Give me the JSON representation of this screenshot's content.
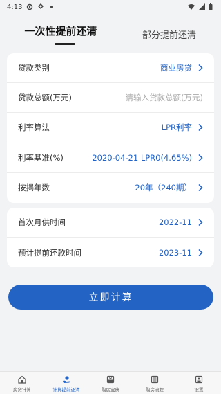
{
  "status_bar": {
    "time": "4:13"
  },
  "tabs": {
    "active_label": "一次性提前还清",
    "inactive_label": "部分提前还清"
  },
  "loan_form": {
    "rows": [
      {
        "label": "贷款类别",
        "value": "商业房贷"
      },
      {
        "label": "贷款总额(万元)",
        "placeholder": "请输入贷款总额(万元)"
      },
      {
        "label": "利率算法",
        "value": "LPR利率"
      },
      {
        "label": "利率基准(%)",
        "value": "2020-04-21 LPR0(4.65%)"
      },
      {
        "label": "按揭年数",
        "value": "20年（240期）"
      }
    ]
  },
  "date_form": {
    "rows": [
      {
        "label": "首次月供时间",
        "value": "2022-11"
      },
      {
        "label": "预计提前还款时间",
        "value": "2023-11"
      }
    ]
  },
  "calculate_button": {
    "label": "立即计算"
  },
  "bottom_nav": {
    "items": [
      {
        "label": "房贷计算",
        "icon": "house-calculator-icon"
      },
      {
        "label": "计算提前还清",
        "icon": "hand-coin-icon",
        "active": true
      },
      {
        "label": "购房宝典",
        "icon": "book-icon"
      },
      {
        "label": "购房流程",
        "icon": "list-icon"
      },
      {
        "label": "设置",
        "icon": "settings-icon"
      }
    ]
  },
  "colors": {
    "accent": "#2263c4",
    "background": "#f2f3f5"
  }
}
